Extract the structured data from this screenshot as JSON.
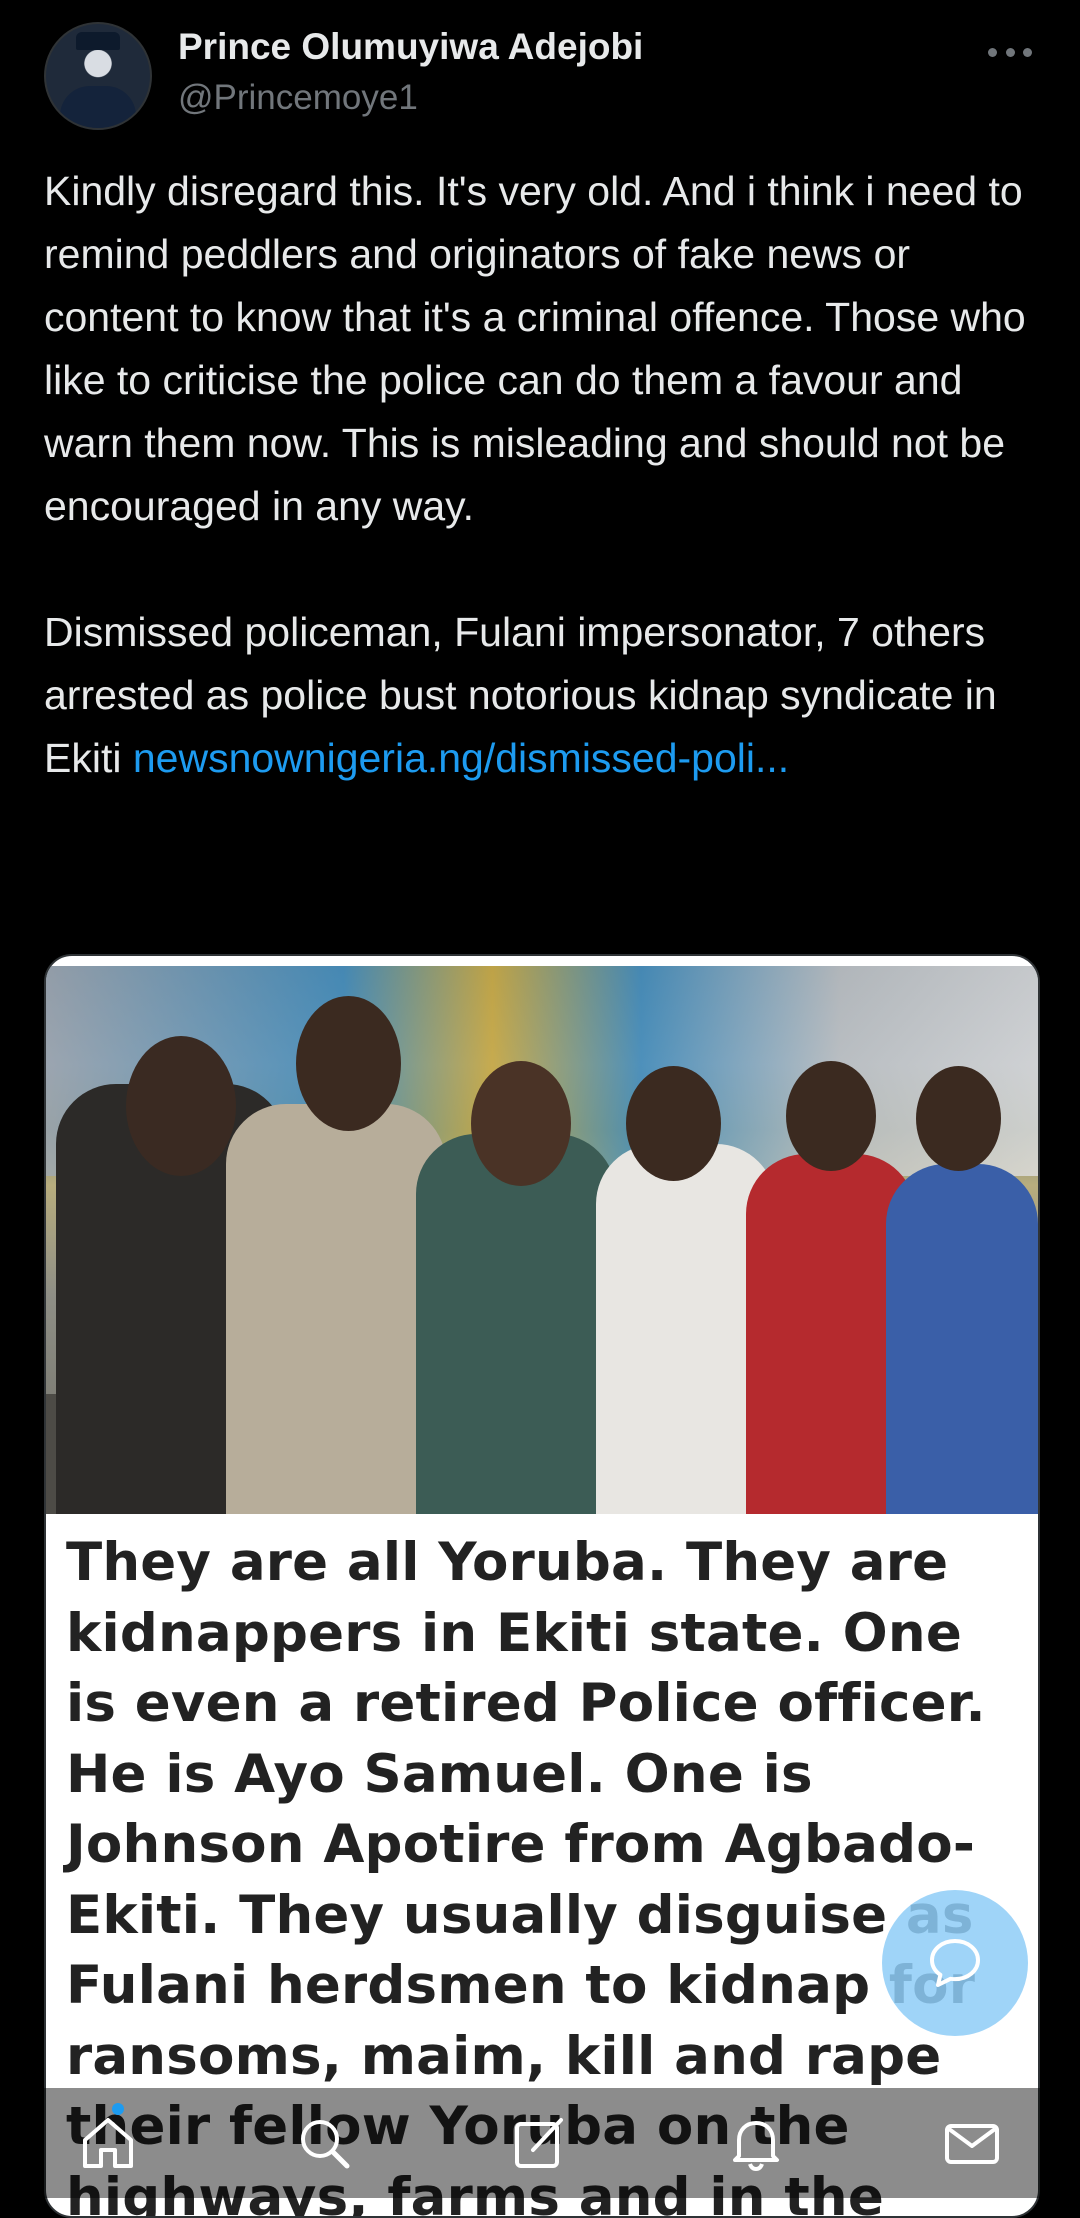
{
  "author": {
    "name": "Prince Olumuyiwa Adejobi",
    "handle": "@Princemoye1"
  },
  "tweet": {
    "paragraph1": "Kindly disregard this. It's very old. And i think i need to remind peddlers and originators of fake news or content to know that it's a criminal offence. Those who like to criticise the police can do them a favour and warn them now. This is misleading and should not be encouraged in any way.",
    "paragraph2": " Dismissed policeman, Fulani impersonator, 7 others arrested as police bust notorious kidnap syndicate in Ekiti ",
    "link": "newsnownigeria.ng/dismissed-poli..."
  },
  "media": {
    "caption": "They are all Yoruba. They are kidnappers in Ekiti state. One is even a retired Police officer. He is Ayo Samuel. One is Johnson Apotire from Agbado-Ekiti. They usually disguise as Fulani herdsmen to kidnap for ransoms, maim, kill and rape their fellow Yoruba on the highways, farms and in the villages!"
  },
  "nav": {
    "items": [
      "home-icon",
      "search-icon",
      "compose-icon",
      "notifications-icon",
      "messages-icon"
    ]
  },
  "colors": {
    "background": "#000000",
    "text": "#e7e9ea",
    "muted": "#71767b",
    "link": "#1d9bf0",
    "fab": "#8eccf7"
  }
}
